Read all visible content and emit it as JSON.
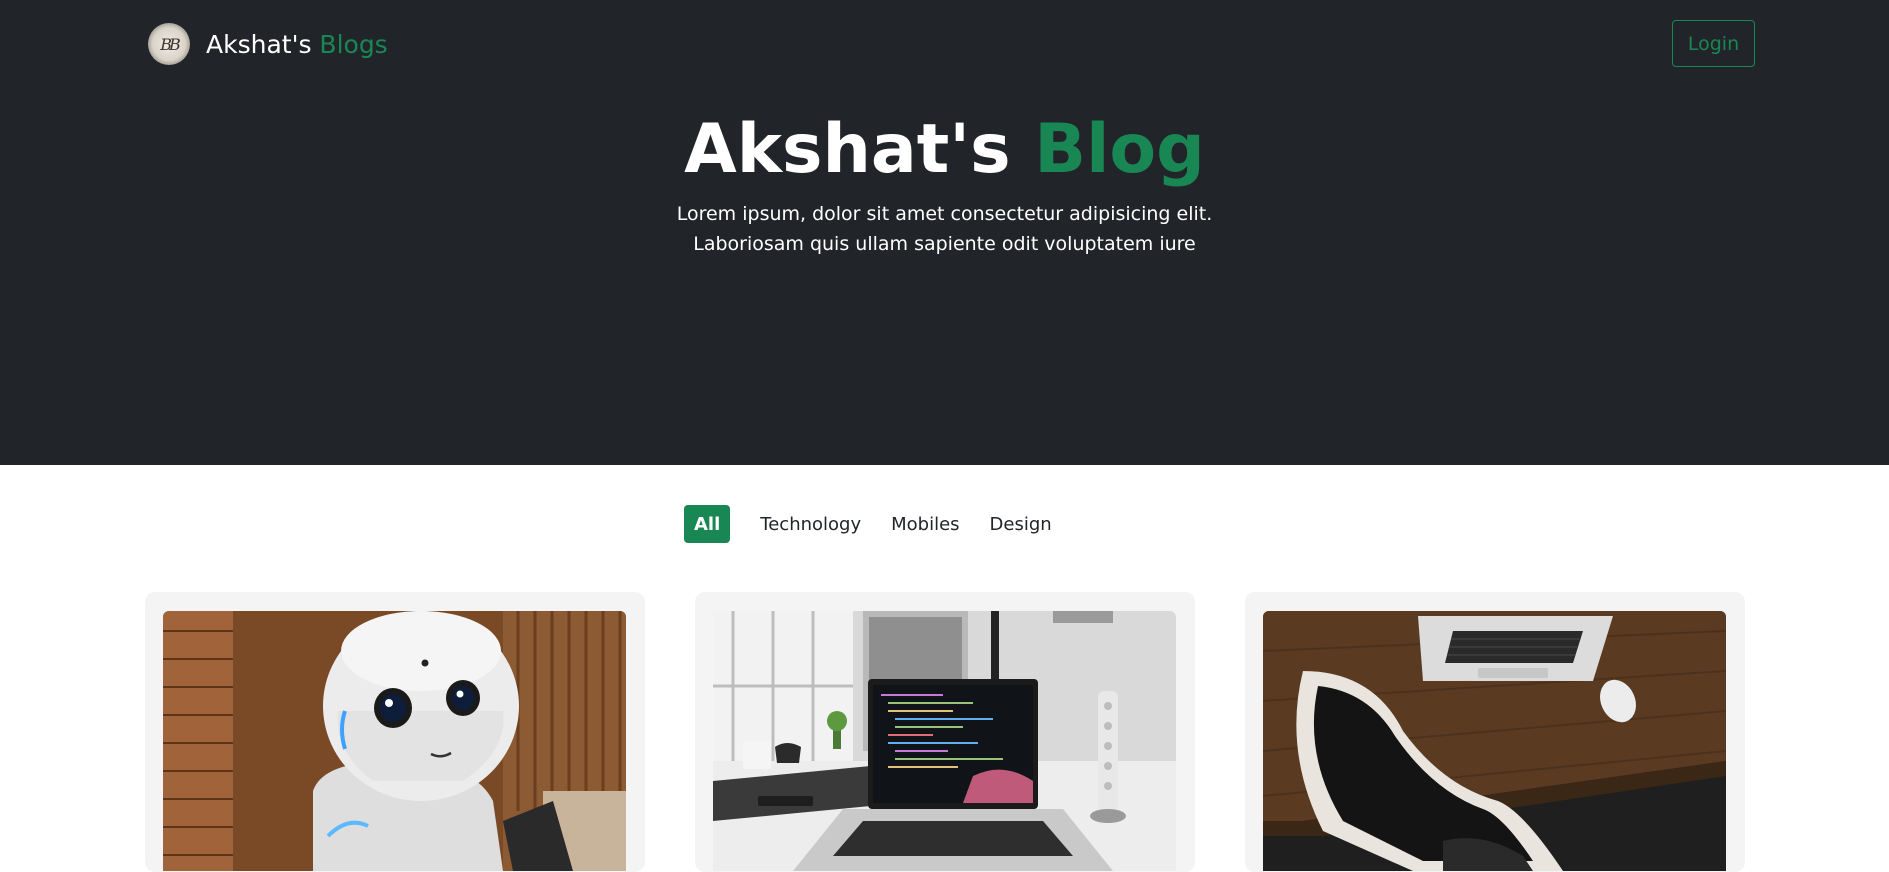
{
  "navbar": {
    "logo_monogram": "BB",
    "brand_prefix": "Akshat's",
    "brand_suffix": "Blogs",
    "login_label": "Login"
  },
  "hero": {
    "title_prefix": "Akshat's",
    "title_suffix": "Blog",
    "subtitle_line1": "Lorem ipsum, dolor sit amet consectetur adipisicing elit.",
    "subtitle_line2": "Laboriosam quis ullam sapiente odit voluptatem iure"
  },
  "filters": [
    {
      "label": "All",
      "active": true
    },
    {
      "label": "Technology",
      "active": false
    },
    {
      "label": "Mobiles",
      "active": false
    },
    {
      "label": "Design",
      "active": false
    }
  ],
  "cards": [
    {
      "image": "robot-photo"
    },
    {
      "image": "laptop-desk-photo"
    },
    {
      "image": "laptop-chair-photo"
    }
  ],
  "colors": {
    "hero_bg": "#212529",
    "accent": "#198754",
    "card_bg": "#f4f4f4"
  }
}
